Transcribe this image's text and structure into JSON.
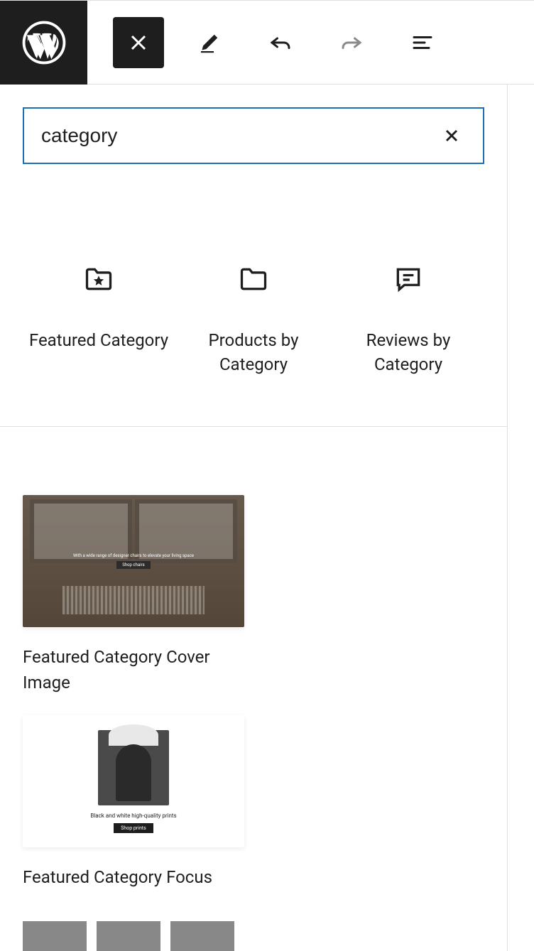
{
  "search": {
    "value": "category"
  },
  "blocks": [
    {
      "label": "Featured Category"
    },
    {
      "label": "Products by Category"
    },
    {
      "label": "Reviews by Category"
    }
  ],
  "patterns": [
    {
      "label": "Featured Category Cover Image",
      "preview_subtitle": "With a wide range of designer chairs to elevate your living space",
      "preview_button": "Shop chairs"
    },
    {
      "label": "Featured Category Focus",
      "preview_subtitle": "Black and white high-quality prints",
      "preview_button": "Shop prints"
    }
  ]
}
